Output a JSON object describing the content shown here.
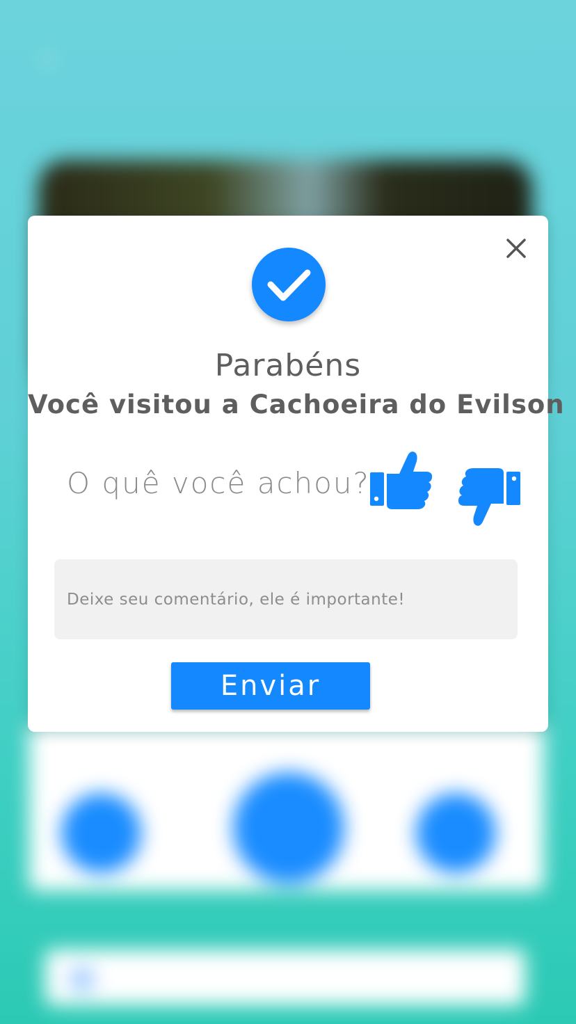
{
  "colors": {
    "accent": "#1488ff",
    "modal_background": "#ffffff",
    "text_primary": "#5e5e5e",
    "text_muted": "#8a8a8a",
    "input_background": "#f1f1f1",
    "screen_gradient_top": "#6cd3dd",
    "screen_gradient_bottom": "#2ccab5"
  },
  "modal": {
    "close_icon": "close-icon",
    "badge_icon": "check-circle-icon",
    "title": "Parabéns",
    "subtitle": "Você visitou a Cachoeira do Evilson",
    "question": "O quê você achou?",
    "like_icon": "thumbs-up-icon",
    "dislike_icon": "thumbs-down-icon",
    "comment_placeholder": "Deixe seu comentário, ele é importante!",
    "send_label": "Enviar"
  }
}
